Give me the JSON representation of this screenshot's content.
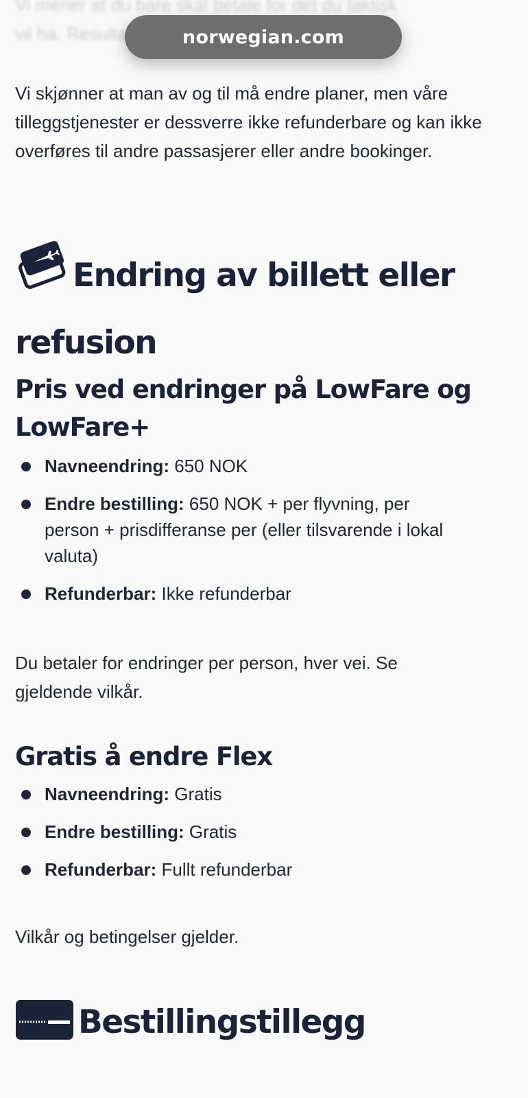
{
  "browser": {
    "url": "norwegian.com"
  },
  "top_fade": {
    "line1": "Vi mener at du bare skal betale for det du faktisk",
    "line2": "vil ha. Resultatet blir lønnsomhet og lave priser."
  },
  "intro": "Vi skjønner at man av og til må endre planer, men våre tilleggstjenester er dessverre ikke refunderbare og kan ikke overføres til andre passasjerer eller andre bookinger.",
  "change_section": {
    "icon": "ticket-plane-icon",
    "title": "Endring av billett eller refusion",
    "lowfare": {
      "heading": "Pris ved endringer på LowFare og LowFare+",
      "items": [
        {
          "label": "Navneendring:",
          "value": "650 NOK"
        },
        {
          "label": "Endre bestilling:",
          "value": "650 NOK + per flyvning, per person + prisdifferanse per (eller tilsvarende i lokal valuta)"
        },
        {
          "label": "Refunderbar:",
          "value": "Ikke refunderbar"
        }
      ],
      "note": "Du betaler for endringer per person, hver vei. Se gjeldende vilkår."
    },
    "flex": {
      "heading": "Gratis å endre Flex",
      "items": [
        {
          "label": "Navneendring:",
          "value": "Gratis"
        },
        {
          "label": "Endre bestilling:",
          "value": "Gratis"
        },
        {
          "label": "Refunderbar:",
          "value": "Fullt refunderbar"
        }
      ],
      "note": "Vilkår og betingelser gjelder."
    }
  },
  "booking_section": {
    "icon": "credit-card-icon",
    "title": "Bestillingstillegg"
  },
  "colors": {
    "background": "#f9f9fa",
    "text": "#1f2736",
    "heading": "#1a2337",
    "url_pill": "#6e6e70"
  }
}
